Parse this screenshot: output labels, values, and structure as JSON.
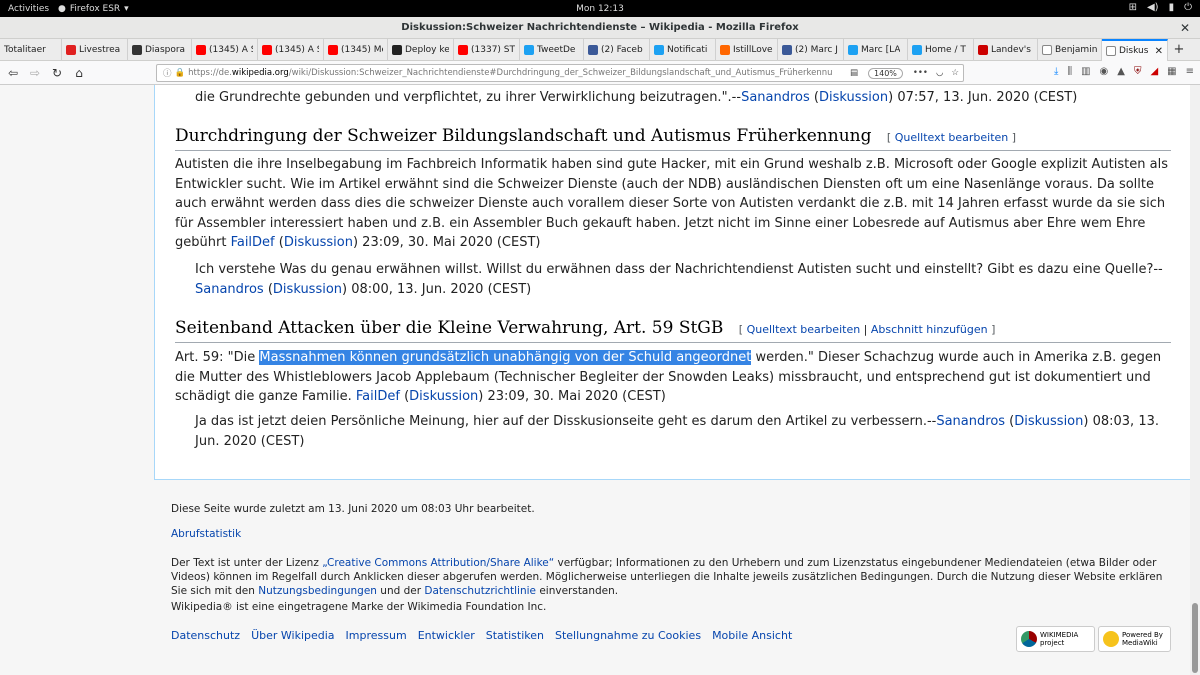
{
  "gnome": {
    "activities": "Activities",
    "app_name": "Firefox ESR",
    "clock": "Mon 12:13"
  },
  "window": {
    "title": "Diskussion:Schweizer Nachrichtendienste – Wikipedia - Mozilla Firefox"
  },
  "tabs": [
    {
      "label": "Totalitaer",
      "color": "#999999"
    },
    {
      "label": "Livestrea",
      "color": "#e02020"
    },
    {
      "label": "Diaspora",
      "color": "#333333"
    },
    {
      "label": "(1345) A S",
      "color": "#ff0000"
    },
    {
      "label": "(1345) A S",
      "color": "#ff0000"
    },
    {
      "label": "(1345) Me",
      "color": "#ff0000"
    },
    {
      "label": "Deploy ke",
      "color": "#222222"
    },
    {
      "label": "(1337) ST",
      "color": "#ff0000"
    },
    {
      "label": "TweetDe",
      "color": "#1da1f2"
    },
    {
      "label": "(2) Faceb",
      "color": "#3b5998"
    },
    {
      "label": "Notificati",
      "color": "#1da1f2"
    },
    {
      "label": "IstillLove",
      "color": "#ff6600"
    },
    {
      "label": "(2) Marc J",
      "color": "#3b5998"
    },
    {
      "label": "Marc [LA",
      "color": "#1da1f2"
    },
    {
      "label": "Home / T",
      "color": "#1da1f2"
    },
    {
      "label": "Landev's",
      "color": "#cc0000"
    },
    {
      "label": "Benjamin",
      "color": "#ffffff"
    },
    {
      "label": "Diskus",
      "color": "#ffffff",
      "active": true
    }
  ],
  "urlbar": {
    "prefix": "https://de.",
    "domain": "wikipedia.org",
    "path": "/wiki/Diskussion:Schweizer_Nachrichtendienste#Durchdringung_der_Schweizer_Bildungslandschaft_und_Autismus_Früherkennu",
    "zoom": "140%"
  },
  "article": {
    "top_line": {
      "text": "die Grundrechte gebunden und verpflichtet, zu ihrer Verwirklichung beizutragen.\".--",
      "user": "Sanandros",
      "open_paren": " (",
      "talk": "Diskussion",
      "rest": ") 07:57, 13. Jun. 2020 (CEST)"
    },
    "section1": {
      "heading": "Durchdringung der Schweizer Bildungslandschaft und Autismus Früherkennung",
      "edit_open": "[ ",
      "edit_link": "Quelltext bearbeiten",
      "edit_close": " ]",
      "para": "Autisten die ihre Inselbegabung im Fachbreich Informatik haben sind gute Hacker, mit ein Grund weshalb z.B. Microsoft oder Google explizit Autisten als Entwickler sucht. Wie im Artikel erwähnt sind die Schweizer Dienste (auch der NDB) ausländischen Diensten oft um eine Nasenlänge voraus. Da sollte auch erwähnt werden dass dies die schweizer Dienste auch vorallem dieser Sorte von Autisten verdankt die z.B. mit 14 Jahren erfasst wurde da sie sich für Assembler interessiert haben und z.B. ein Assembler Buch gekauft haben. Jetzt nicht im Sinne einer Lobesrede auf Autismus aber Ehre wem Ehre gebührt ",
      "para_user": "FailDef",
      "para_open": " (",
      "para_talk": "Diskussion",
      "para_rest": ") 23:09, 30. Mai 2020 (CEST)",
      "reply": "Ich verstehe Was du genau erwähnen willst. Willst du erwähnen dass der Nachrichtendienst Autisten sucht und einstellt? Gibt es dazu eine Quelle?--",
      "reply_user": "Sanandros",
      "reply_open": " (",
      "reply_talk": "Diskussion",
      "reply_rest": ") 08:00, 13. Jun. 2020 (CEST)"
    },
    "section2": {
      "heading": "Seitenband Attacken über die Kleine Verwahrung, Art. 59 StGB",
      "edit_open": "[ ",
      "edit_link": "Quelltext bearbeiten",
      "edit_sep": " | ",
      "edit_link2": "Abschnitt hinzufügen",
      "edit_close": " ]",
      "para_pre": "Art. 59: \"Die ",
      "para_highlight": "Massnahmen können grundsätzlich unabhängig von der Schuld angeordnet",
      "para_post": " werden.\" Dieser Schachzug wurde auch in Amerika z.B. gegen die Mutter des Whistleblowers Jacob Applebaum (Technischer Begleiter der Snowden Leaks) missbraucht, und entsprechend gut ist dokumentiert und schädigt die ganze Familie. ",
      "para_user": "FailDef",
      "para_open": " (",
      "para_talk": "Diskussion",
      "para_rest": ") 23:09, 30. Mai 2020 (CEST)",
      "reply": "Ja das ist jetzt deien Persönliche Meinung, hier auf der Disskusionseite geht es darum den Artikel zu verbessern.--",
      "reply_user": "Sanandros",
      "reply_open": " (",
      "reply_talk": "Diskussion",
      "reply_rest": ") 08:03, 13. Jun. 2020 (CEST)"
    }
  },
  "footer": {
    "last_edit": "Diese Seite wurde zuletzt am 13. Juni 2020 um 08:03 Uhr bearbeitet.",
    "stats": "Abrufstatistik",
    "license_pre": "Der Text ist unter der Lizenz ",
    "license_link": "„Creative Commons Attribution/Share Alike“",
    "license_mid": " verfügbar; Informationen zu den Urhebern und zum Lizenzstatus eingebundener Mediendateien (etwa Bilder oder Videos) können im Regelfall durch Anklicken dieser abgerufen werden. Möglicherweise unterliegen die Inhalte jeweils zusätzlichen Bedingungen. Durch die Nutzung dieser Website erklären Sie sich mit den ",
    "terms_link": "Nutzungsbedingungen",
    "license_and": " und der ",
    "privacy_link": "Datenschutzrichtlinie",
    "license_end": " einverstanden.",
    "trademark": "Wikipedia® ist eine eingetragene Marke der Wikimedia Foundation Inc.",
    "links": [
      "Datenschutz",
      "Über Wikipedia",
      "Impressum",
      "Entwickler",
      "Statistiken",
      "Stellungnahme zu Cookies",
      "Mobile Ansicht"
    ],
    "badge1": "WIKIMEDIA project",
    "badge2": "Powered By MediaWiki"
  }
}
